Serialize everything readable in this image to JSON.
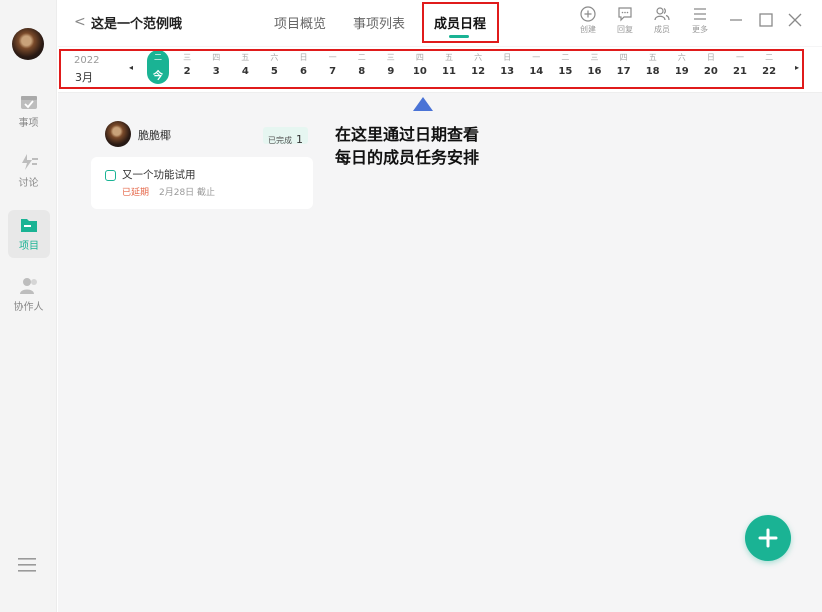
{
  "sidebar": {
    "items": [
      {
        "label": "事项",
        "icon": "calendar-check-icon"
      },
      {
        "label": "讨论",
        "icon": "chat-bolt-icon"
      },
      {
        "label": "项目",
        "icon": "folder-icon",
        "active": true
      },
      {
        "label": "协作人",
        "icon": "people-icon"
      }
    ],
    "menu_icon": "hamburger-icon"
  },
  "header": {
    "back_glyph": "<",
    "project_title": "这是一个范例哦",
    "tabs": [
      {
        "label": "项目概览"
      },
      {
        "label": "事项列表"
      },
      {
        "label": "成员日程",
        "active": true
      }
    ],
    "actions": [
      {
        "label": "创建",
        "icon": "plus-circle-icon"
      },
      {
        "label": "回复",
        "icon": "comment-icon"
      },
      {
        "label": "成员",
        "icon": "members-icon"
      },
      {
        "label": "更多",
        "icon": "more-lines-icon"
      }
    ]
  },
  "dates": {
    "year": "2022",
    "month": "3月",
    "prev_glyph": "◂",
    "next_glyph": "▸",
    "days": [
      {
        "wd": "二",
        "num": "今"
      },
      {
        "wd": "三",
        "num": "2"
      },
      {
        "wd": "四",
        "num": "3"
      },
      {
        "wd": "五",
        "num": "4"
      },
      {
        "wd": "六",
        "num": "5"
      },
      {
        "wd": "日",
        "num": "6"
      },
      {
        "wd": "一",
        "num": "7"
      },
      {
        "wd": "二",
        "num": "8"
      },
      {
        "wd": "三",
        "num": "9"
      },
      {
        "wd": "四",
        "num": "10"
      },
      {
        "wd": "五",
        "num": "11"
      },
      {
        "wd": "六",
        "num": "12"
      },
      {
        "wd": "日",
        "num": "13"
      },
      {
        "wd": "一",
        "num": "14"
      },
      {
        "wd": "二",
        "num": "15"
      },
      {
        "wd": "三",
        "num": "16"
      },
      {
        "wd": "四",
        "num": "17"
      },
      {
        "wd": "五",
        "num": "18"
      },
      {
        "wd": "六",
        "num": "19"
      },
      {
        "wd": "日",
        "num": "20"
      },
      {
        "wd": "一",
        "num": "21"
      },
      {
        "wd": "二",
        "num": "22"
      }
    ]
  },
  "annotation": {
    "line1": "在这里通过日期查看",
    "line2": "每日的成员任务安排"
  },
  "member": {
    "name": "脆脆椰",
    "done_label": "已完成",
    "done_count": "1"
  },
  "task": {
    "title": "又一个功能试用",
    "status": "已延期",
    "due": "2月28日 截止"
  },
  "colors": {
    "accent": "#1ab394",
    "highlight_box": "#e01b1b",
    "pointer": "#4a73d6",
    "overdue": "#e5684a"
  }
}
